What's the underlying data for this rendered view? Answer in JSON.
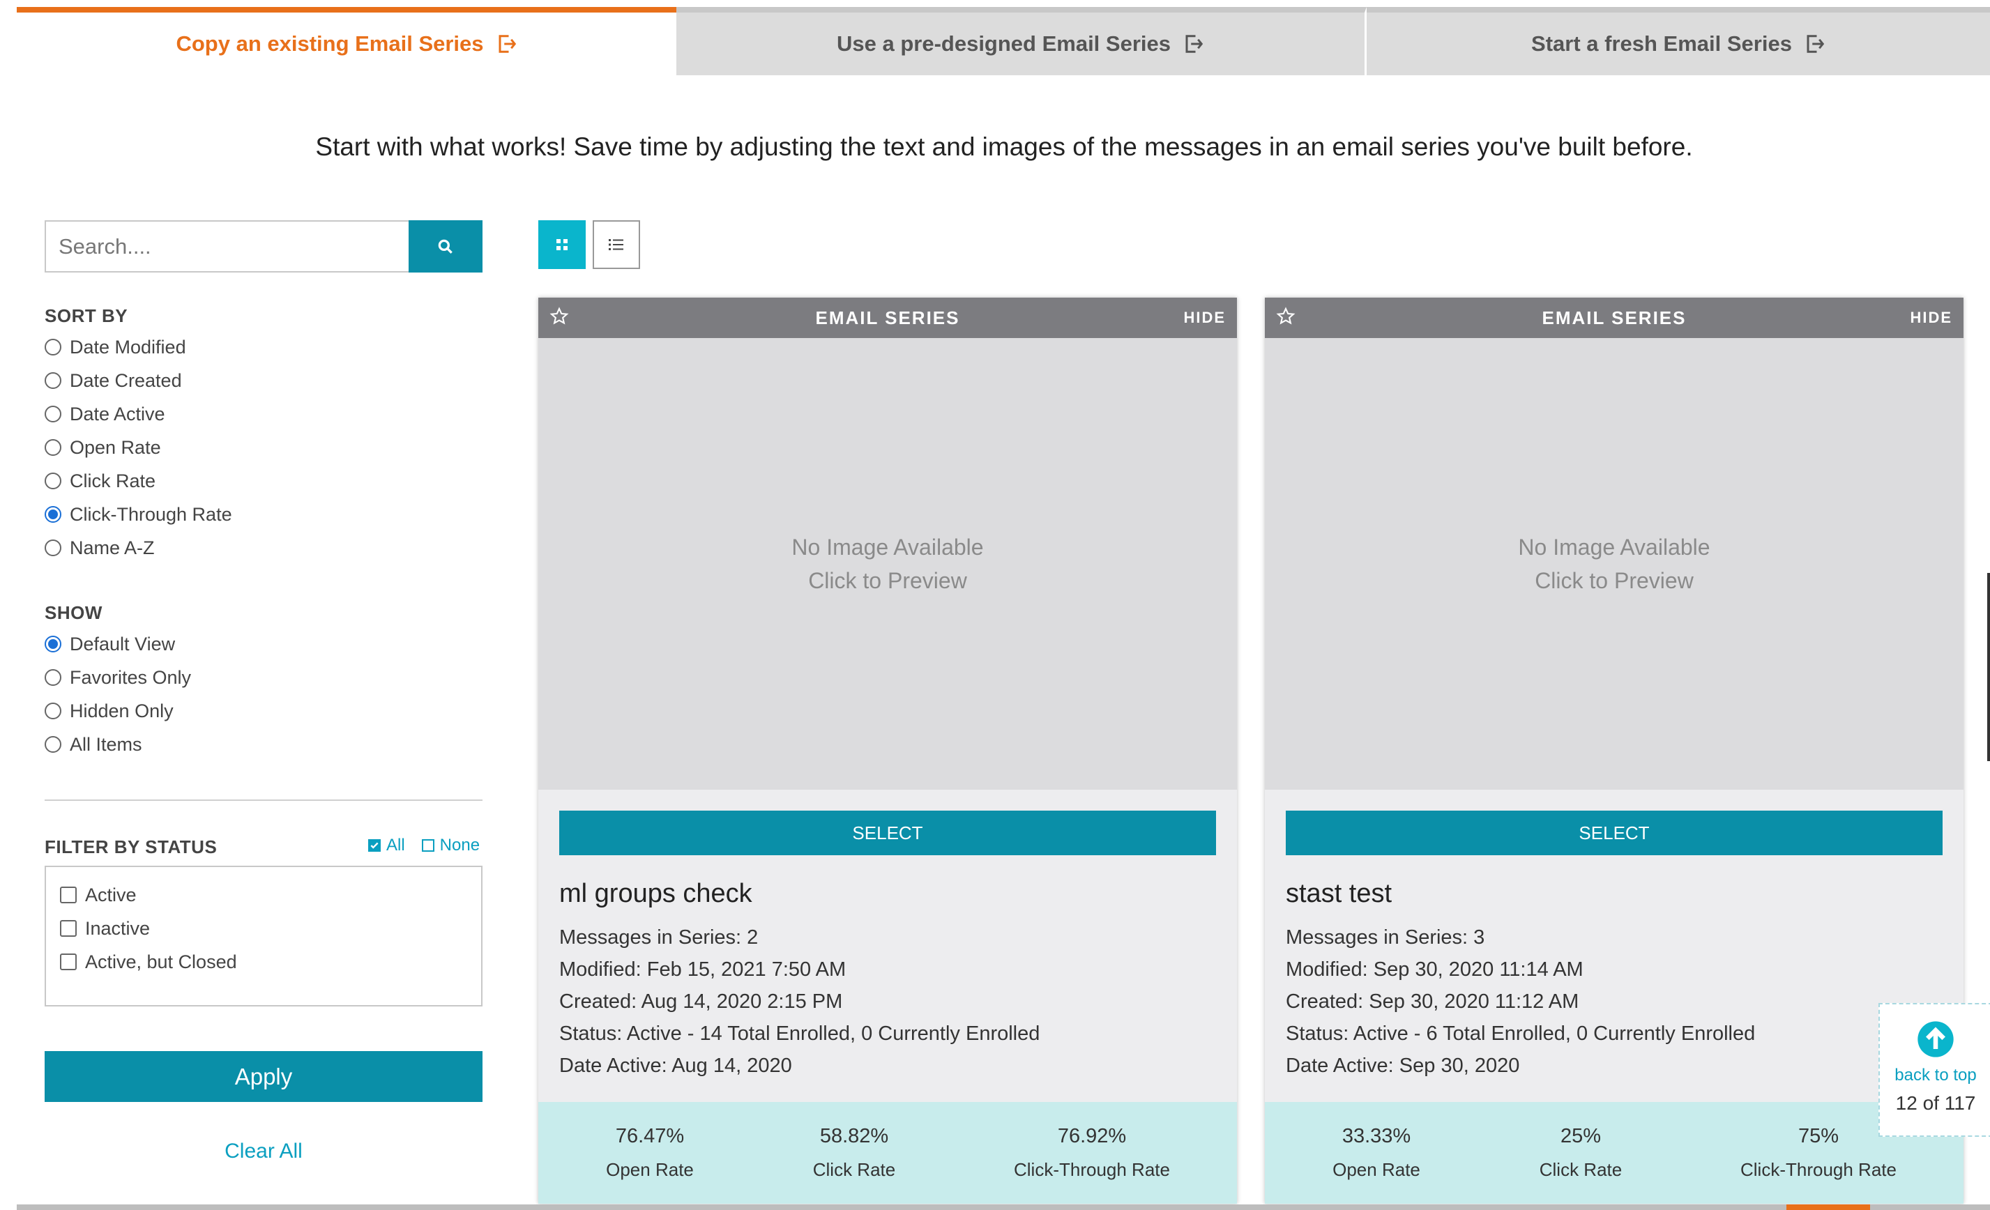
{
  "tabs": [
    {
      "label": "Copy an existing Email Series",
      "active": true
    },
    {
      "label": "Use a pre-designed Email Series",
      "active": false
    },
    {
      "label": "Start a fresh Email Series",
      "active": false
    }
  ],
  "intro": "Start with what works! Save time by adjusting the text and images of the messages in an email series you've built before.",
  "search": {
    "placeholder": "Search...."
  },
  "sort": {
    "label": "SORT BY",
    "options": [
      "Date Modified",
      "Date Created",
      "Date Active",
      "Open Rate",
      "Click Rate",
      "Click-Through Rate",
      "Name A-Z"
    ],
    "selected": "Click-Through Rate"
  },
  "show": {
    "label": "SHOW",
    "options": [
      "Default View",
      "Favorites Only",
      "Hidden Only",
      "All Items"
    ],
    "selected": "Default View"
  },
  "filter": {
    "label": "FILTER BY STATUS",
    "all_label": "All",
    "none_label": "None",
    "options": [
      "Active",
      "Inactive",
      "Active, but Closed"
    ]
  },
  "apply_label": "Apply",
  "clear_label": "Clear All",
  "cards": [
    {
      "header": "EMAIL SERIES",
      "hide": "HIDE",
      "preview_line1": "No Image Available",
      "preview_line2": "Click to Preview",
      "select": "SELECT",
      "name": "ml groups check",
      "messages": "Messages in Series: 2",
      "modified": "Modified: Feb 15, 2021 7:50 AM",
      "created": "Created: Aug 14, 2020 2:15 PM",
      "status": "Status: Active - 14 Total Enrolled, 0 Currently Enrolled",
      "date_active": "Date Active: Aug 14, 2020",
      "open_rate": "76.47%",
      "click_rate": "58.82%",
      "ctr": "76.92%",
      "open_label": "Open Rate",
      "click_label": "Click Rate",
      "ctr_label": "Click-Through Rate"
    },
    {
      "header": "EMAIL SERIES",
      "hide": "HIDE",
      "preview_line1": "No Image Available",
      "preview_line2": "Click to Preview",
      "select": "SELECT",
      "name": "stast test",
      "messages": "Messages in Series: 3",
      "modified": "Modified: Sep 30, 2020 11:14 AM",
      "created": "Created: Sep 30, 2020 11:12 AM",
      "status": "Status: Active - 6 Total Enrolled, 0 Currently Enrolled",
      "date_active": "Date Active: Sep 30, 2020",
      "open_rate": "33.33%",
      "click_rate": "25%",
      "ctr": "75%",
      "open_label": "Open Rate",
      "click_label": "Click Rate",
      "ctr_label": "Click-Through Rate"
    }
  ],
  "back_to_top": {
    "label": "back to top",
    "count": "12 of 117"
  },
  "colors": {
    "accent": "#e8701a",
    "teal": "#0a8fa8",
    "stats_bg": "#c8ecec",
    "link": "#0a9fc0"
  }
}
